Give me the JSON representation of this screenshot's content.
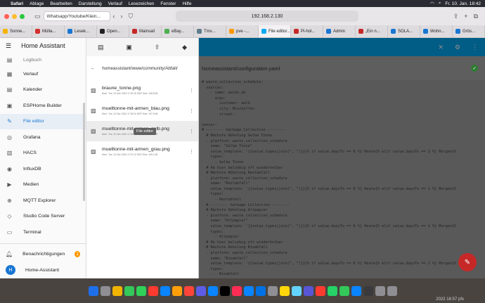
{
  "menubar": {
    "app": "Safari",
    "items": [
      "Ablage",
      "Bearbeiten",
      "Darstellung",
      "Verlauf",
      "Lesezeichen",
      "Fenster",
      "Hilfe"
    ],
    "clock": "Fr. 10. Jan. 18:42"
  },
  "browser": {
    "tab_group": "Whatsapp/Youtube/Klein...",
    "url": "192.168.2.130",
    "tabs": [
      {
        "label": "Sonne...",
        "color": "#f4b400"
      },
      {
        "label": "Müllа...",
        "color": "#d32f2f"
      },
      {
        "label": "Lesek...",
        "color": "#1976d2"
      },
      {
        "label": "Open...",
        "color": "#222222"
      },
      {
        "label": "Mainsail",
        "color": "#c62828"
      },
      {
        "label": "eBay...",
        "color": "#4caf50"
      },
      {
        "label": "Tmx...",
        "color": "#607d8b"
      },
      {
        "label": "pve -...",
        "color": "#ff9800"
      },
      {
        "label": "File editor...",
        "color": "#03a9f4"
      },
      {
        "label": "Pi-hol...",
        "color": "#c62828"
      },
      {
        "label": "Admin",
        "color": "#1976d2"
      },
      {
        "label": "„Ein n...",
        "color": "#c62828"
      },
      {
        "label": "SOLA...",
        "color": "#1976d2"
      },
      {
        "label": "Wohn...",
        "color": "#1976d2"
      },
      {
        "label": "Grös...",
        "color": "#1976d2"
      }
    ]
  },
  "sidebar": {
    "title": "Home Assistant",
    "top_item": "Logbuch",
    "items": [
      {
        "label": "Verlauf",
        "icon": "▦"
      },
      {
        "label": "Kalender",
        "icon": "▤"
      },
      {
        "label": "ESPHome Builder",
        "icon": "▣"
      },
      {
        "label": "File editor",
        "icon": "✎"
      },
      {
        "label": "Grafana",
        "icon": "◎"
      },
      {
        "label": "HACS",
        "icon": "▥"
      },
      {
        "label": "InfluxDB",
        "icon": "◉"
      },
      {
        "label": "Medien",
        "icon": "▶"
      },
      {
        "label": "MQTT Explorer",
        "icon": "⊕"
      },
      {
        "label": "Studio Code Server",
        "icon": "◇"
      },
      {
        "label": "Terminal",
        "icon": "▭"
      }
    ],
    "notifications_label": "Benachrichtigungen",
    "notifications_count": "1",
    "user_label": "Home-Assistant",
    "user_initial": "H"
  },
  "filebrowser": {
    "path": "homeassistant/www/community/Abfall/",
    "files": [
      {
        "name": "braune_tonne.png",
        "meta": "Mod.: Tue, 31 Dec 2024 17:00:16 GMT  Size: 128.8 kB"
      },
      {
        "name": "muelltonne-mit-armen_blau.png",
        "meta": "Mod.: Tue, 31 Dec 2024 17:00:24 GMT  Size: 107.5 kB"
      },
      {
        "name": "muelltonne-mit-armen_gelb.png",
        "meta": "Mod.: Tue, 31 Dec 2024 17:00:08 GMT  Size: 107.3 kB"
      },
      {
        "name": "muelltonne-mit-armen_grau.png",
        "meta": "Mod.: Tue, 31 Dec 2024 17:07:12 GMT  Size: 126.1 kB"
      }
    ],
    "tooltip": "File editor"
  },
  "editor": {
    "file_path": "homeassistant/configuration.yaml",
    "code": "# waste_collection_schedule:\n  sources:\n    - name: awido_de\n      args:\n        customer: awld\n        city: Bischoffen\n        street:\n\nsensor:\n# -------- Garbage Collection --------\n  # Nächste Abholung Gelbe Tonne\n  - platform: waste_collection_schedule\n    name: \"Gelbe Tonne\"\n    value_template: '{{value.types|join(\", \")}}{% if value.daysTo == 0 %} Heute{% elif value.daysTo == 1 %} Morgen{%\n    types:\n      - Gelbe Tonne\n  # Ab hier beliebig oft wiederholbar\n  # Nächste Abholung Restabfall\n  - platform: waste_collection_schedule\n    name: \"Restabfall\"\n    value_template: '{{value.types|join(\", \")}}{% if value.daysTo == 0 %} Heute{% elif value.daysTo == 1 %} Morgen{%\n    types:\n      - Restabfall\n  # -------- Garbage Collection --------\n  # Nächste Abholung Altpapier\n  - platform: waste_collection_schedule\n    name: \"Altpapier\"\n    value_template: '{{value.types|join(\", \")}}{% if value.daysTo == 0 %} Heute{% elif value.daysTo == 1 %} Morgen{%\n    types:\n      - Altpapier\n  # Ab hier beliebig oft wiederholbar\n  # Nächste Abholung Bioabfall\n  - platform: waste_collection_schedule\n    name: \"Bioabfall\"\n    value_template: '{{value.types|join(\", \")}}{% if value.daysTo == 0 %} Heute{% elif value.daysTo == 1 %} Morgen{%\n    types:\n      - Bioabfall"
  },
  "dock": {
    "time_label": "2022 16:57 pfx"
  },
  "colors": {
    "accent": "#03a9f4",
    "active": "#1976d2",
    "fab": "#c62828"
  }
}
